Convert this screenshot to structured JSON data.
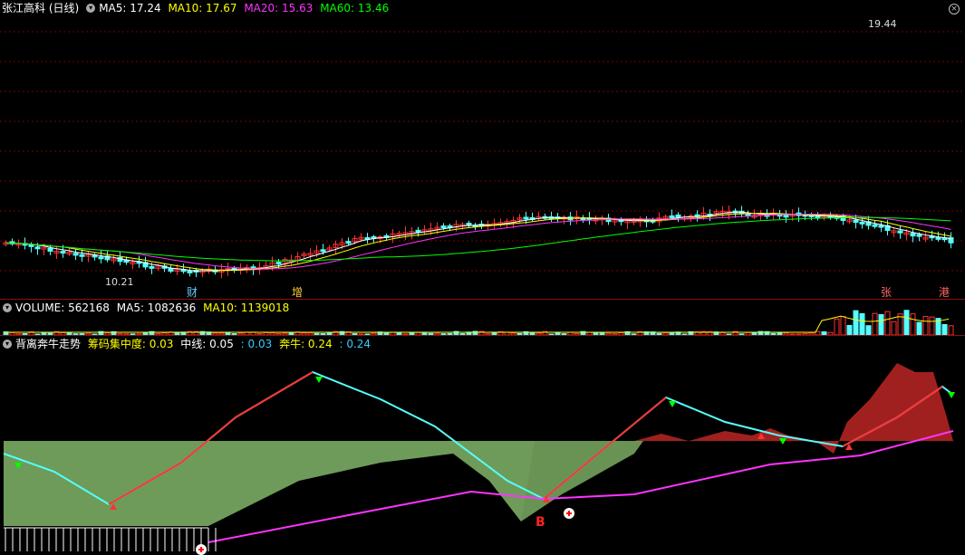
{
  "price_panel": {
    "title": "张江高科 (日线)",
    "ma": [
      {
        "label": "MA5: 17.24",
        "color": "#ffffff"
      },
      {
        "label": "MA10: 17.67",
        "color": "#ffff00"
      },
      {
        "label": "MA20: 15.63",
        "color": "#ff33ff"
      },
      {
        "label": "MA60: 13.46",
        "color": "#00ff00"
      }
    ],
    "high_label": "19.44",
    "low_label": "10.21",
    "events": [
      {
        "label": "财",
        "color": "#66ccff"
      },
      {
        "label": "增",
        "color": "#ffcc33"
      },
      {
        "label": "张",
        "color": "#ff6666"
      },
      {
        "label": "港",
        "color": "#ff6666"
      }
    ],
    "close_icon": "close-icon"
  },
  "volume_panel": {
    "items": [
      {
        "label": "VOLUME: 562168",
        "color": "#ffffff"
      },
      {
        "label": "MA5: 1082636",
        "color": "#ffffff"
      },
      {
        "label": "MA10: 1139018",
        "color": "#ffff00"
      }
    ]
  },
  "indicator_panel": {
    "title": "背离奔牛走势",
    "items": [
      {
        "label": "筹码集中度: 0.03",
        "color": "#ffff00"
      },
      {
        "label": "中线: 0.05",
        "color": "#ffffff"
      },
      {
        "label": ": 0.03",
        "color": "#33ccff"
      },
      {
        "label": "奔牛: 0.24",
        "color": "#ffff00"
      },
      {
        "label": ": 0.24",
        "color": "#33ccff"
      }
    ],
    "signal_b": "B"
  },
  "colors": {
    "up": "#ff3232",
    "down": "#54ffff",
    "grid": "#7a0000",
    "ma5": "#ffffff",
    "ma10": "#ffff00",
    "ma20": "#ff33ff",
    "ma60": "#00ff00"
  }
}
